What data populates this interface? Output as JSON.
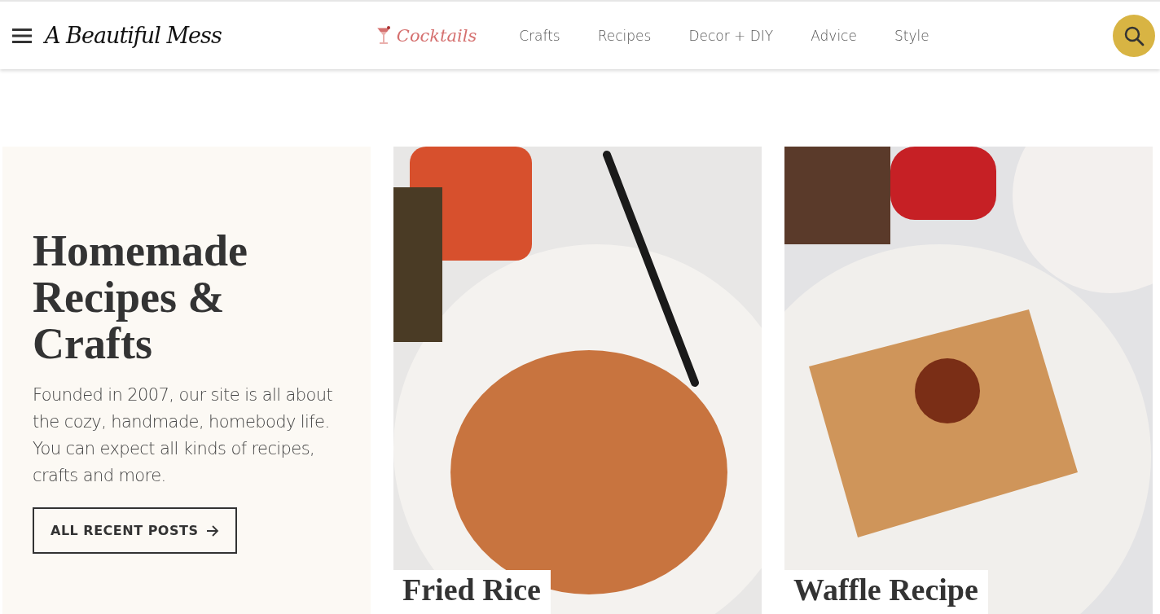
{
  "header": {
    "logo": "A Beautiful Mess",
    "nav": [
      {
        "label": "Cocktails",
        "kind": "featured"
      },
      {
        "label": "Crafts",
        "kind": "plain"
      },
      {
        "label": "Recipes",
        "kind": "plain"
      },
      {
        "label": "Decor + DIY",
        "kind": "plain"
      },
      {
        "label": "Advice",
        "kind": "plain"
      },
      {
        "label": "Style",
        "kind": "plain"
      }
    ]
  },
  "intro": {
    "title": "Homemade Recipes & Crafts",
    "text": "Founded in 2007, our site is all about the cozy, handmade, homebody life. You can expect all kinds of recipes, crafts and more.",
    "button": "ALL RECENT POSTS"
  },
  "posts": [
    {
      "title": "Fried Rice"
    },
    {
      "title": "Waffle Recipe"
    }
  ]
}
